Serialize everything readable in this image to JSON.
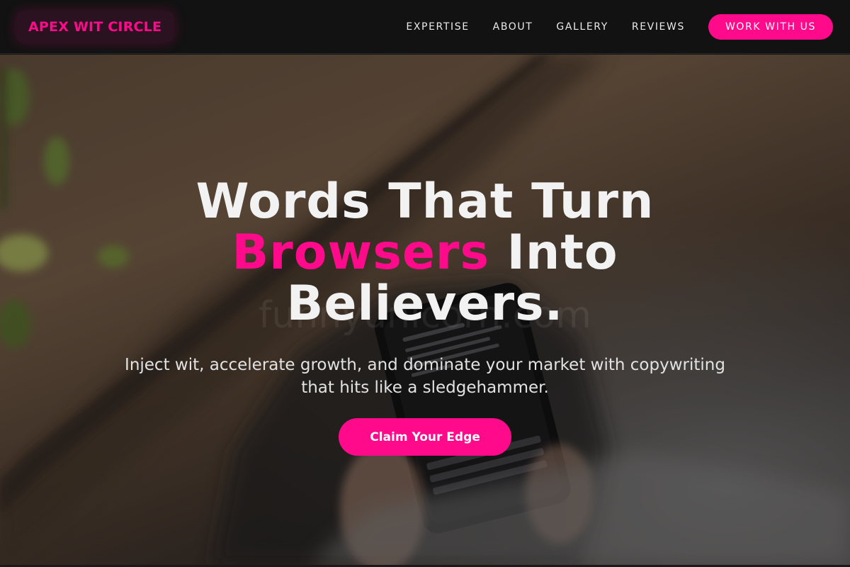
{
  "brand": {
    "name": "APEX WIT CIRCLE",
    "accent_color": "#ff0a8a"
  },
  "nav": {
    "links": [
      "EXPERTISE",
      "ABOUT",
      "GALLERY",
      "REVIEWS"
    ],
    "cta_label": "WORK WITH US"
  },
  "hero": {
    "headline_line1": "Words That Turn",
    "headline_accent": "Browsers",
    "headline_line2_rest": " Into",
    "headline_line3": "Believers.",
    "subtitle": "Inject wit, accelerate growth, and dominate your market with copywriting that hits like a sledgehammer.",
    "cta_label": "Claim Your Edge",
    "watermark": "funnyunicorn.com",
    "background_image": "hands-holding-smartphone-photo"
  }
}
